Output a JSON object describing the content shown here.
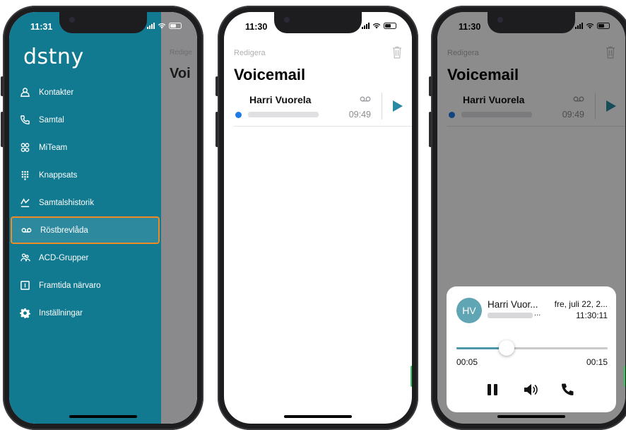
{
  "phone1": {
    "status_time": "11:31",
    "logo": "dstny",
    "background_edit": "Redige",
    "background_title": "Voi",
    "menu": [
      {
        "label": "Kontakter",
        "icon": "person-icon"
      },
      {
        "label": "Samtal",
        "icon": "phone-icon"
      },
      {
        "label": "MiTeam",
        "icon": "team-icon"
      },
      {
        "label": "Knappsats",
        "icon": "keypad-icon"
      },
      {
        "label": "Samtalshistorik",
        "icon": "call-history-icon"
      },
      {
        "label": "Röstbrevlåda",
        "icon": "voicemail-icon",
        "active": true
      },
      {
        "label": "ACD-Grupper",
        "icon": "acd-group-icon"
      },
      {
        "label": "Framtida närvaro",
        "icon": "future-presence-icon"
      },
      {
        "label": "Inställningar",
        "icon": "settings-gear-icon"
      }
    ]
  },
  "phone2": {
    "status_time": "11:30",
    "edit_label": "Redigera",
    "title": "Voicemail",
    "voicemail": {
      "name": "Harri Vuorela",
      "time": "09:49",
      "unread": true
    }
  },
  "phone3": {
    "status_time": "11:30",
    "edit_label": "Redigera",
    "title": "Voicemail",
    "voicemail": {
      "name": "Harri Vuorela",
      "time": "09:49"
    },
    "player": {
      "avatar_initials": "HV",
      "caller_name": "Harri Vuor...",
      "number_suffix": "...",
      "date": "fre, juli 22, 2...",
      "clock": "11:30:11",
      "elapsed": "00:05",
      "duration": "00:15",
      "progress": 0.33
    }
  },
  "colors": {
    "brand_teal": "#117a91",
    "active_outline": "#f08a24",
    "play_teal": "#2b8aa3",
    "unread_blue": "#1f7be8"
  }
}
